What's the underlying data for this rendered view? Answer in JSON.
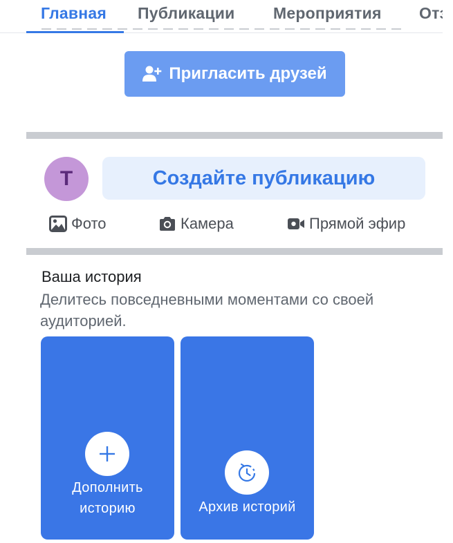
{
  "tabs": [
    {
      "label": "Главная",
      "active": true
    },
    {
      "label": "Публикации",
      "active": false
    },
    {
      "label": "Мероприятия",
      "active": false
    },
    {
      "label": "Отз",
      "active": false
    }
  ],
  "invite": {
    "label": "Пригласить друзей",
    "icon": "add-user-icon"
  },
  "composer": {
    "avatar_initial": "T",
    "placeholder": "Создайте публикацию",
    "actions": [
      {
        "label": "Фото",
        "icon": "photo-icon"
      },
      {
        "label": "Камера",
        "icon": "camera-icon"
      },
      {
        "label": "Прямой эфир",
        "icon": "live-video-icon"
      }
    ]
  },
  "stories": {
    "title": "Ваша история",
    "subtitle": "Делитесь повседневными моментами со своей аудиторией.",
    "cards": [
      {
        "label": "Дополнить историю",
        "icon": "plus-icon"
      },
      {
        "label": "Архив историй",
        "icon": "history-clock-icon"
      }
    ]
  },
  "colors": {
    "accent": "#3578e5",
    "invite_button": "#6b9cf1",
    "story_card": "#3a76e6",
    "compose_bg": "#e7f0fd",
    "avatar_bg": "#c497d8",
    "separator": "#c9ccd1"
  }
}
